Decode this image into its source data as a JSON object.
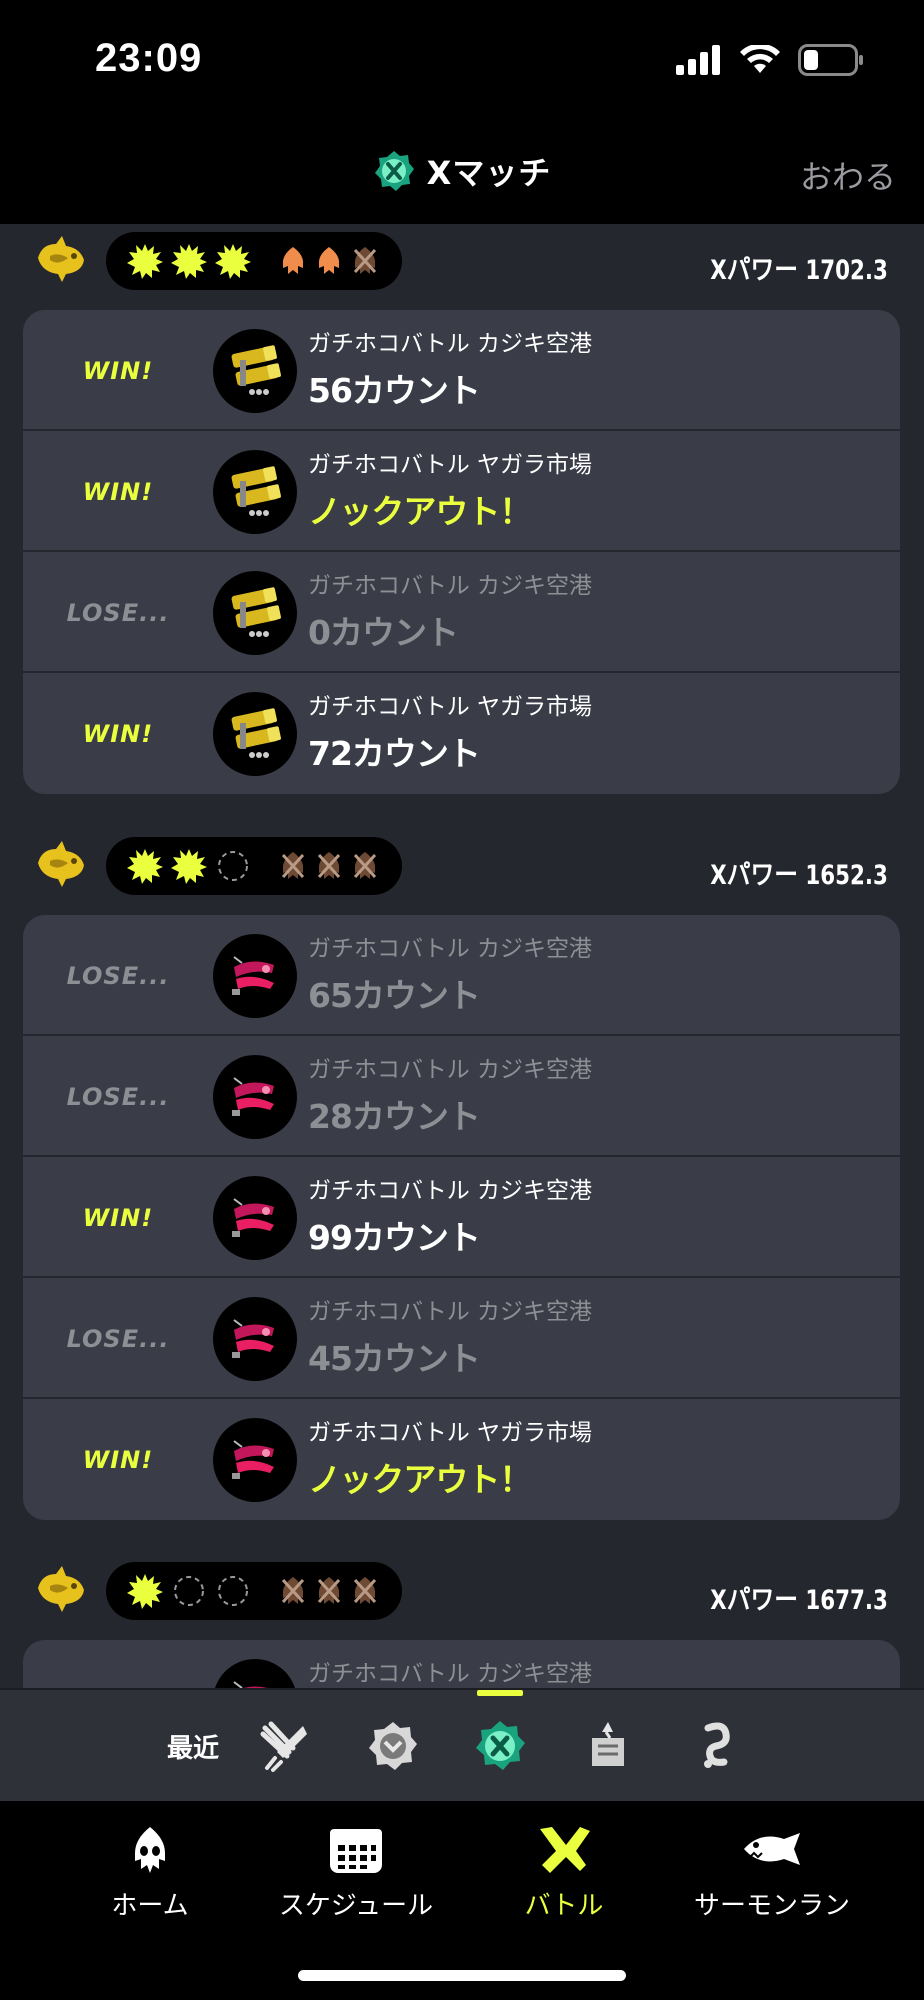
{
  "status_bar": {
    "time": "23:09"
  },
  "header": {
    "title": "Xマッチ",
    "done_label": "おわる"
  },
  "sets": [
    {
      "xpower": "Xパワー 1702.3",
      "wins": [
        "win",
        "win",
        "win"
      ],
      "losses": [
        "used",
        "used",
        "lost"
      ],
      "weapon": "yellow",
      "battles": [
        {
          "result": "WIN!",
          "outcome": "win",
          "stage": "ガチホコバトル カジキ空港",
          "score": "56カウント",
          "ko": false
        },
        {
          "result": "WIN!",
          "outcome": "win",
          "stage": "ガチホコバトル ヤガラ市場",
          "score": "ノックアウト！",
          "ko": true
        },
        {
          "result": "LOSE...",
          "outcome": "lose",
          "stage": "ガチホコバトル カジキ空港",
          "score": "0カウント",
          "ko": false
        },
        {
          "result": "WIN!",
          "outcome": "win",
          "stage": "ガチホコバトル ヤガラ市場",
          "score": "72カウント",
          "ko": false
        }
      ]
    },
    {
      "xpower": "Xパワー 1652.3",
      "wins": [
        "win",
        "win",
        "empty"
      ],
      "losses": [
        "lost",
        "lost",
        "lost"
      ],
      "weapon": "pink",
      "battles": [
        {
          "result": "LOSE...",
          "outcome": "lose",
          "stage": "ガチホコバトル カジキ空港",
          "score": "65カウント",
          "ko": false
        },
        {
          "result": "LOSE...",
          "outcome": "lose",
          "stage": "ガチホコバトル カジキ空港",
          "score": "28カウント",
          "ko": false
        },
        {
          "result": "WIN!",
          "outcome": "win",
          "stage": "ガチホコバトル カジキ空港",
          "score": "99カウント",
          "ko": false
        },
        {
          "result": "LOSE...",
          "outcome": "lose",
          "stage": "ガチホコバトル カジキ空港",
          "score": "45カウント",
          "ko": false
        },
        {
          "result": "WIN!",
          "outcome": "win",
          "stage": "ガチホコバトル ヤガラ市場",
          "score": "ノックアウト！",
          "ko": true
        }
      ]
    },
    {
      "xpower": "Xパワー 1677.3",
      "wins": [
        "win",
        "empty",
        "empty"
      ],
      "losses": [
        "lost",
        "lost",
        "lost"
      ],
      "weapon": "pink",
      "battles": [
        {
          "result": "",
          "outcome": "lose",
          "stage": "ガチホコバトル カジキ空港",
          "score": "",
          "ko": false
        }
      ]
    }
  ],
  "mode_bar": {
    "recent_label": "最近"
  },
  "tabs": [
    {
      "label": "ホーム",
      "icon": "squid-icon"
    },
    {
      "label": "スケジュール",
      "icon": "calendar-icon"
    },
    {
      "label": "バトル",
      "icon": "battle-icon",
      "active": true
    },
    {
      "label": "サーモンラン",
      "icon": "salmon-icon"
    }
  ],
  "colors": {
    "accent": "#eaff3d",
    "background": "#25272f",
    "card": "#3a3d47",
    "muted": "#8e8f95"
  }
}
